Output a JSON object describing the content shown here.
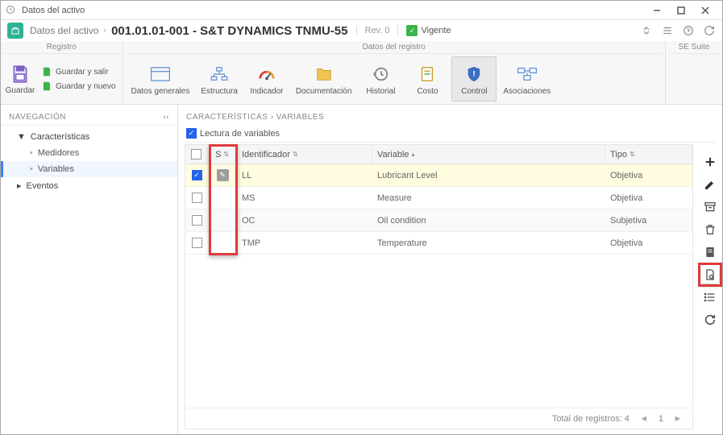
{
  "window": {
    "title": "Datos del activo"
  },
  "header": {
    "module": "Datos del activo",
    "code": "001.01.01-001 - S&T DYNAMICS TNMU-55",
    "revision": "Rev. 0",
    "status": "Vigente"
  },
  "ribbon": {
    "groups": [
      {
        "title": "Registro"
      },
      {
        "title": "Datos del registro"
      },
      {
        "title": "SE Suite"
      }
    ],
    "save": "Guardar",
    "save_exit": "Guardar y salir",
    "save_new": "Guardar y nuevo",
    "buttons": [
      "Datos generales",
      "Estructura",
      "Indicador",
      "Documentación",
      "Historial",
      "Costo",
      "Control",
      "Asociaciones"
    ]
  },
  "nav": {
    "header": "NAVEGACIÓN",
    "items": [
      {
        "label": "Características",
        "children": [
          "Medidores",
          "Variables"
        ]
      },
      {
        "label": "Eventos"
      }
    ]
  },
  "content": {
    "breadcrumb": [
      "CARACTERÍSTICAS",
      "VARIABLES"
    ],
    "read_label": "Lectura de variables"
  },
  "table": {
    "columns": [
      "S",
      "Identificador",
      "Variable",
      "Tipo"
    ],
    "rows": [
      {
        "id": "LL",
        "variable": "Lubricant Level",
        "tipo": "Objetiva",
        "selected": true
      },
      {
        "id": "MS",
        "variable": "Measure",
        "tipo": "Objetiva",
        "selected": false
      },
      {
        "id": "OC",
        "variable": "Oil condition",
        "tipo": "Subjetiva",
        "selected": false
      },
      {
        "id": "TMP",
        "variable": "Temperature",
        "tipo": "Objetiva",
        "selected": false
      }
    ],
    "total_label": "Total de registros: 4",
    "page": "1"
  }
}
